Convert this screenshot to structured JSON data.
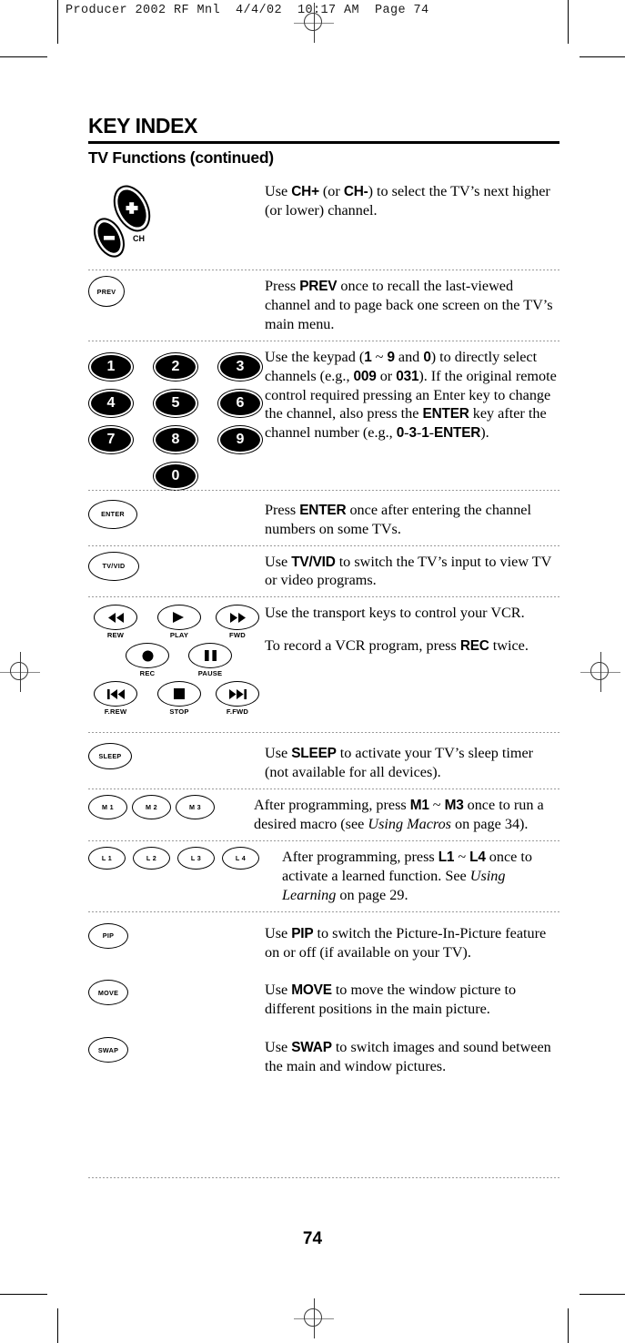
{
  "print_header": "Producer 2002 RF Mnl  4/4/02  10:17 AM  Page 74",
  "page_title": "KEY INDEX",
  "section_title": "TV Functions (continued)",
  "page_number": "74",
  "rows": [
    {
      "key_type": "ch-rocker",
      "key_labels": [
        "+",
        "CH",
        "–"
      ],
      "text_html": "Use <b>CH+</b> (or <b>CH-</b>) to select the TV’s next higher (or lower) channel."
    },
    {
      "key_type": "prev",
      "key_labels": [
        "PREV"
      ],
      "text_html": "Press <b>PREV</b> once to recall the last-viewed channel and to page back one screen on  the TV’s main menu."
    },
    {
      "key_type": "keypad",
      "key_labels": [
        "1",
        "2",
        "3",
        "4",
        "5",
        "6",
        "7",
        "8",
        "9",
        "0"
      ],
      "text_html": "Use the keypad (<b>1</b> ~ <b>9</b> and <b>0</b>) to directly select channels (e.g., <b>009</b> or <b>031</b>). If the original remote control required pressing an Enter key to change the channel, also press the <b>ENTER</b> key after the channel number (e.g., <b>0</b>-<b>3</b>-<b>1</b>-<b>ENTER</b>)."
    },
    {
      "key_type": "enter",
      "key_labels": [
        "ENTER"
      ],
      "text_html": "Press <b>ENTER</b> once after entering the channel numbers on some TVs."
    },
    {
      "key_type": "tvvid",
      "key_labels": [
        "TV/VID"
      ],
      "text_html": "Use <b>TV/VID</b> to switch the TV’s input to view TV or video programs."
    },
    {
      "key_type": "transport",
      "key_labels": [
        "REW",
        "PLAY",
        "FWD",
        "REC",
        "PAUSE",
        "F.REW",
        "STOP",
        "F.FWD"
      ],
      "text_html": "Use the transport keys to control your VCR.",
      "text_html_2": "To record a VCR program, press <b>REC</b> twice."
    },
    {
      "key_type": "sleep",
      "key_labels": [
        "SLEEP"
      ],
      "text_html": "Use <b>SLEEP</b> to activate your TV’s sleep timer (not available for all devices)."
    },
    {
      "key_type": "macro",
      "key_labels": [
        "M 1",
        "M 2",
        "M 3"
      ],
      "text_html": "After programming, press <b>M1</b> ~ <b>M3</b> once to run a desired macro (see <i>Using Macros</i> on page 34)."
    },
    {
      "key_type": "learn",
      "key_labels": [
        "L 1",
        "L 2",
        "L 3",
        "L 4"
      ],
      "text_html": "After programming, press <b>L1</b> ~ <b>L4</b> once to activate a learned function. See <i>Using Learning</i> on page 29."
    },
    {
      "key_type": "pip",
      "key_labels": [
        "PIP"
      ],
      "text_html": "Use <b>PIP</b> to switch the Picture-In-Picture feature on or off (if available on your TV)."
    },
    {
      "key_type": "move",
      "key_labels": [
        "MOVE"
      ],
      "text_html": "Use <b>MOVE</b> to move the window picture to different positions in the main picture."
    },
    {
      "key_type": "swap",
      "key_labels": [
        "SWAP"
      ],
      "text_html": "Use <b>SWAP</b> to switch images and sound between the main and window pictures."
    }
  ]
}
